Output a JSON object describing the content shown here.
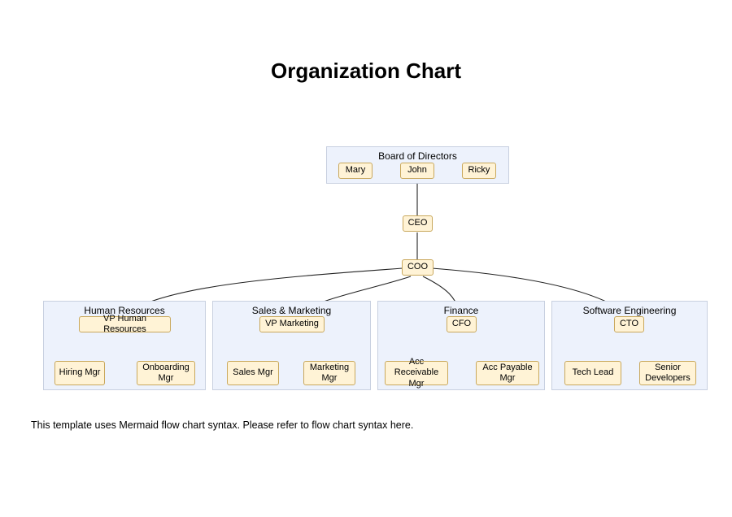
{
  "title": "Organization Chart",
  "footer_text": "This template uses Mermaid flow chart syntax. Please refer to flow chart syntax here.",
  "board": {
    "group_label": "Board of Directors",
    "members": [
      "Mary",
      "John",
      "Ricky"
    ]
  },
  "executives": {
    "ceo": "CEO",
    "coo": "COO"
  },
  "departments": {
    "hr": {
      "group_label": "Human Resources",
      "head": "VP Human Resources",
      "reports": [
        "Hiring Mgr",
        "Onboarding Mgr"
      ]
    },
    "sales": {
      "group_label": "Sales & Marketing",
      "head": "VP Marketing",
      "reports": [
        "Sales Mgr",
        "Marketing Mgr"
      ]
    },
    "finance": {
      "group_label": "Finance",
      "head": "CFO",
      "reports": [
        "Acc Receivable Mgr",
        "Acc Payable Mgr"
      ]
    },
    "eng": {
      "group_label": "Software Engineering",
      "head": "CTO",
      "reports": [
        "Tech Lead",
        "Senior Developers"
      ]
    }
  }
}
